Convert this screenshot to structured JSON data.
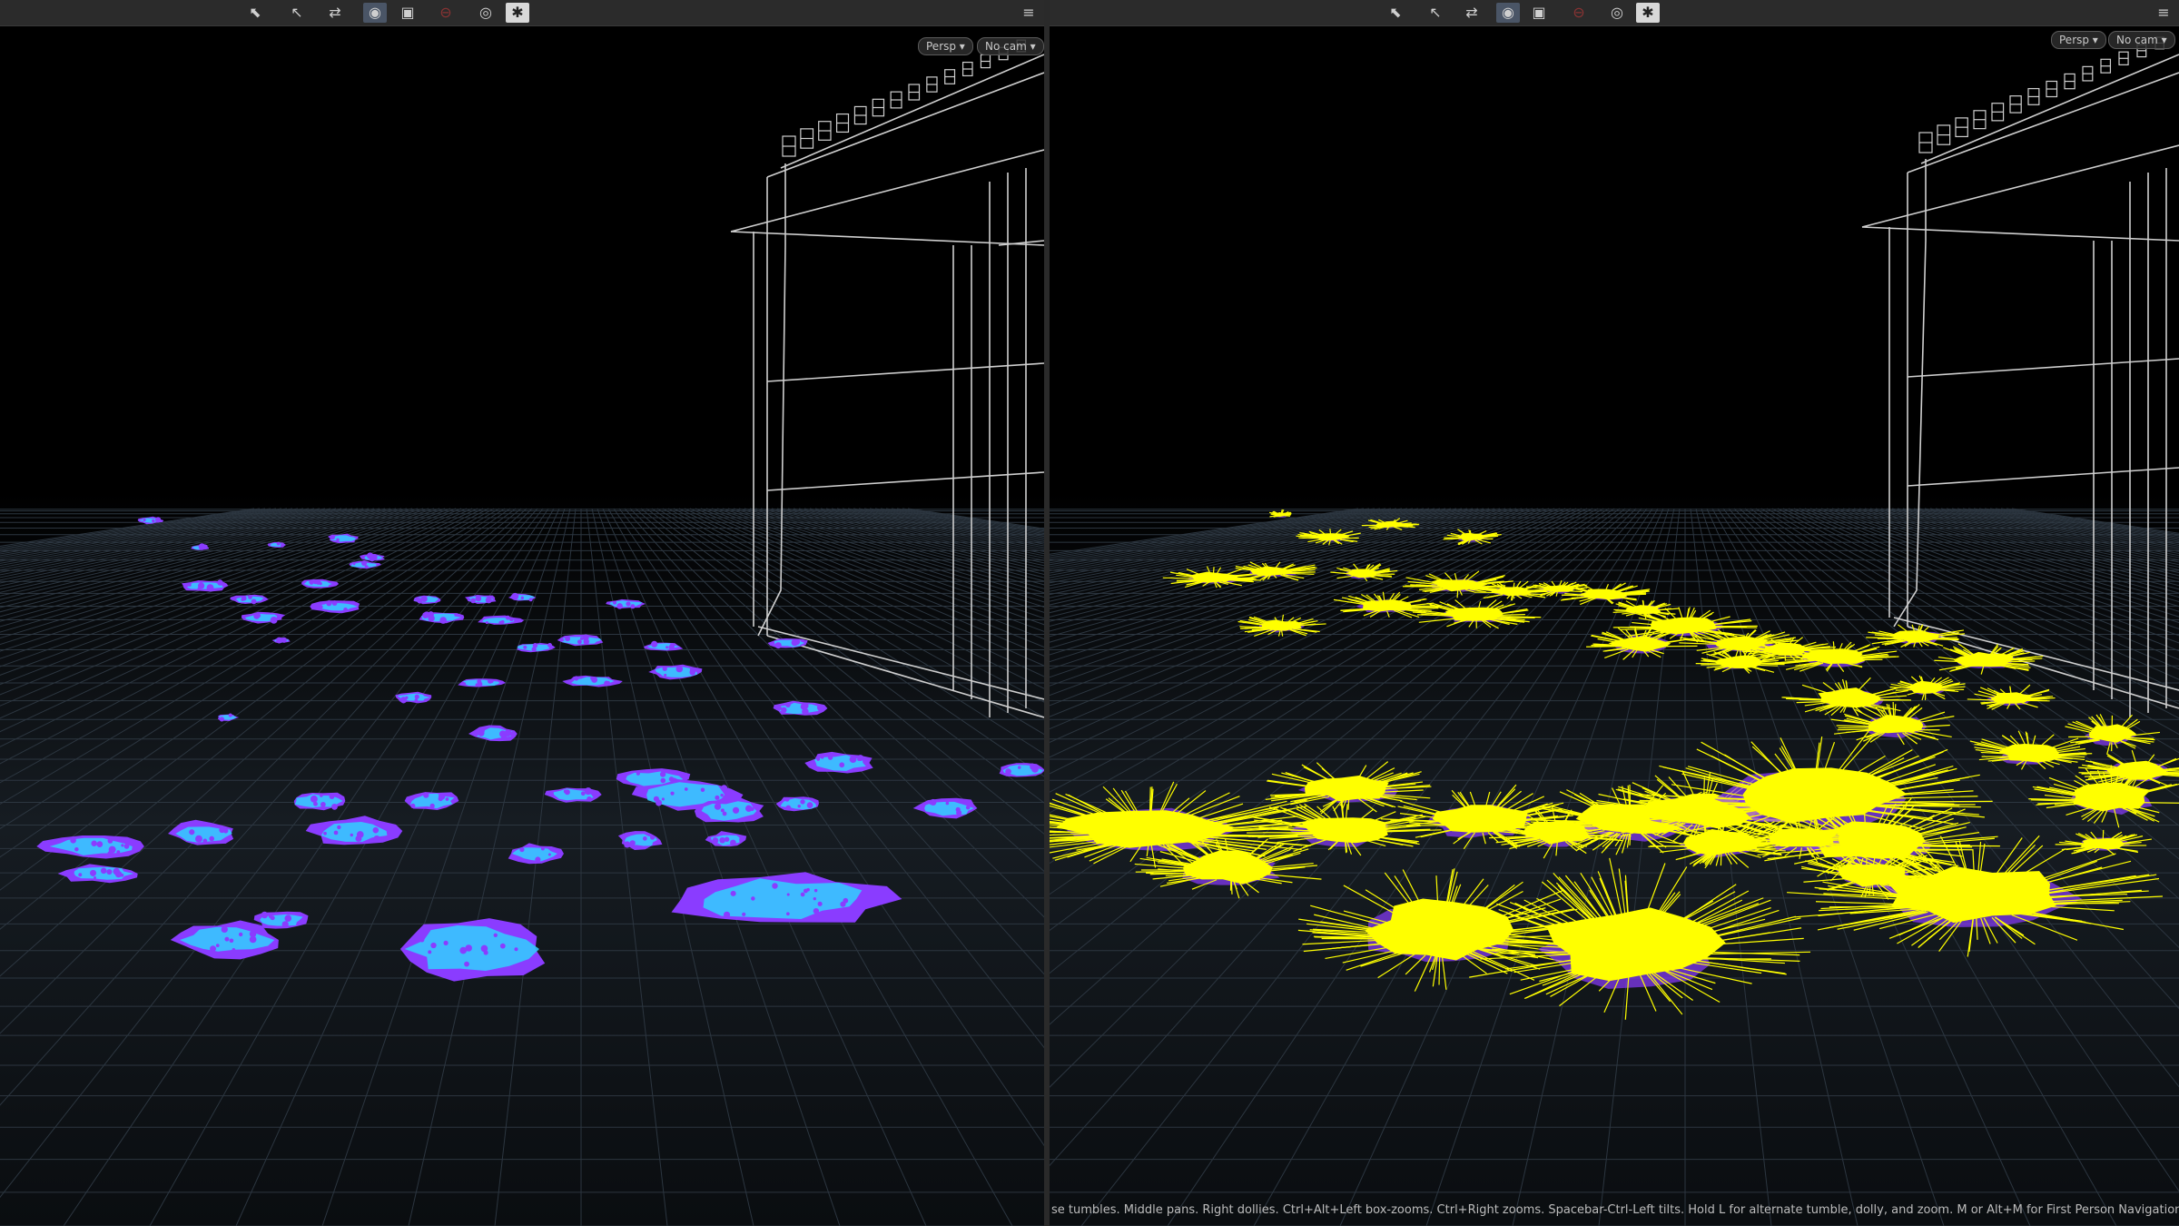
{
  "toolbar": {
    "icons": [
      "select-icon",
      "move-icon",
      "handle-icon",
      "camera-icon",
      "view-icon",
      "disabled-icon",
      "snapshot-icon",
      "display-options-icon"
    ],
    "glyphs": {
      "select": "⬉",
      "move": "↖",
      "handle": "⇄",
      "camera": "◉",
      "view": "▣",
      "disabled": "⊖",
      "snapshot": "◎",
      "options": "✱",
      "layout": "≡"
    }
  },
  "left_viewport": {
    "persp_label": "Persp ▾",
    "cam_label": "No cam ▾"
  },
  "right_viewport": {
    "persp_label": "Persp ▾",
    "cam_label": "No cam ▾",
    "status_text": "se tumbles. Middle pans. Right dollies. Ctrl+Alt+Left box-zooms. Ctrl+Right zooms. Spacebar-Ctrl-Left tilts. Hold L for alternate tumble, dolly, and zoom. M or Alt+M for First Person Navigation."
  },
  "colors": {
    "background": "#000000",
    "grid": "#2c3640",
    "wireframe": "#cfcfcf",
    "patch_fill": "#35c8ff",
    "patch_edge": "#8a3cff",
    "fur": "#ffff00"
  }
}
